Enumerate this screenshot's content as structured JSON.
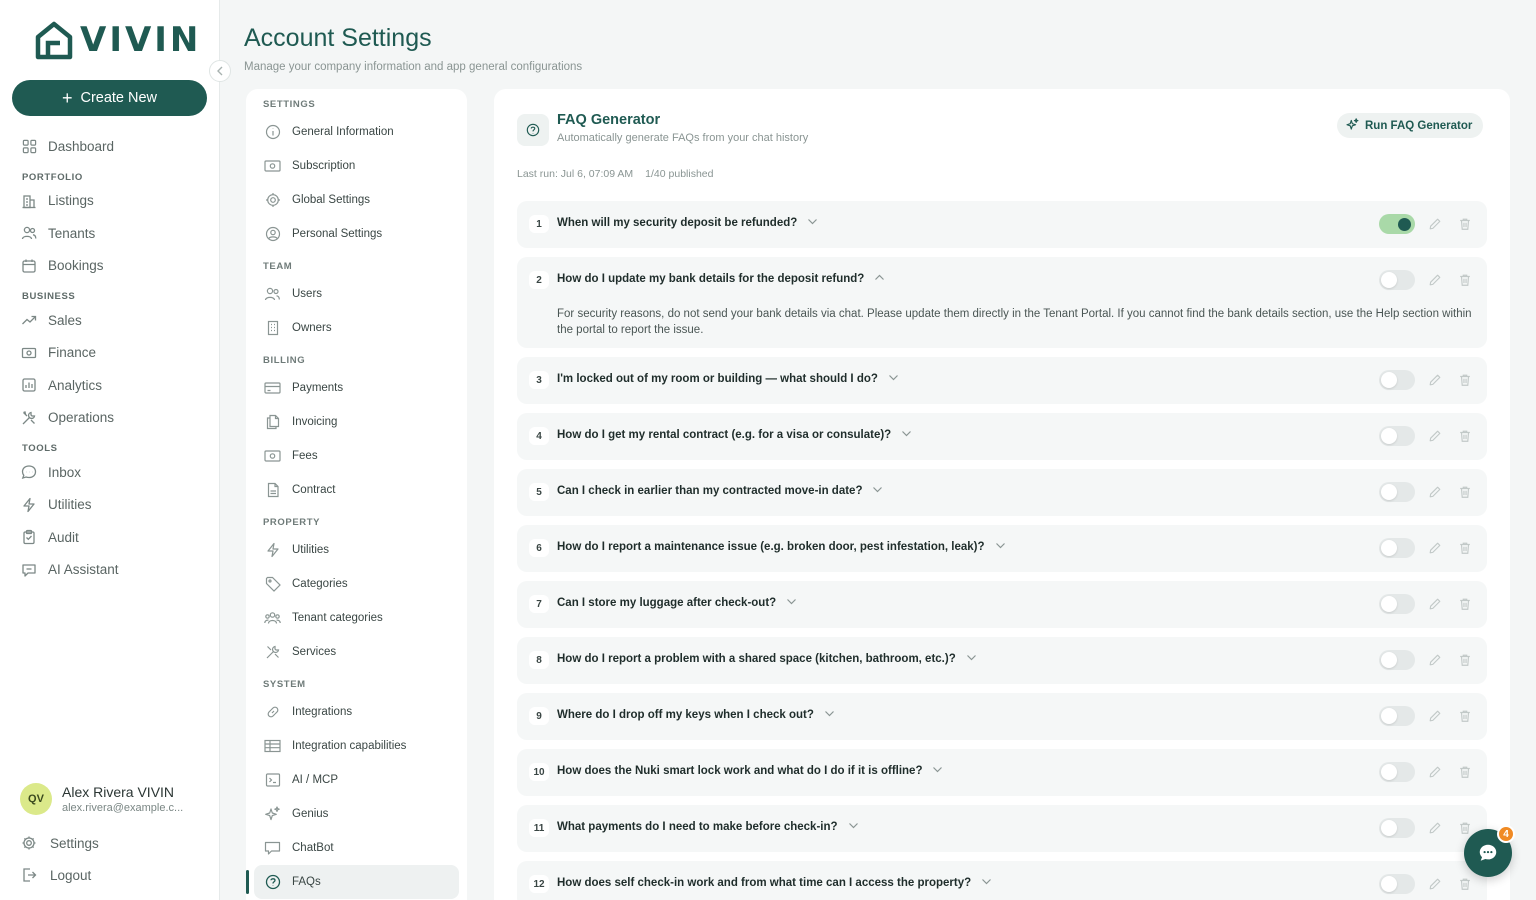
{
  "brand": {
    "name": "VIVIN",
    "color": "#1f5a52"
  },
  "sidebar": {
    "create_label": "Create New",
    "dashboard": {
      "label": "Dashboard",
      "icon": "grid-icon"
    },
    "sections": [
      {
        "title": "PORTFOLIO",
        "items": [
          {
            "label": "Listings",
            "icon": "building-icon"
          },
          {
            "label": "Tenants",
            "icon": "users-icon"
          },
          {
            "label": "Bookings",
            "icon": "calendar-icon"
          }
        ]
      },
      {
        "title": "BUSINESS",
        "items": [
          {
            "label": "Sales",
            "icon": "trend-icon"
          },
          {
            "label": "Finance",
            "icon": "cash-icon"
          },
          {
            "label": "Analytics",
            "icon": "chart-icon"
          },
          {
            "label": "Operations",
            "icon": "tools-icon"
          }
        ]
      },
      {
        "title": "TOOLS",
        "items": [
          {
            "label": "Inbox",
            "icon": "chat-icon"
          },
          {
            "label": "Utilities",
            "icon": "bolt-icon"
          },
          {
            "label": "Audit",
            "icon": "clipboard-icon"
          },
          {
            "label": "AI Assistant",
            "icon": "ai-chat-icon"
          }
        ]
      }
    ],
    "user": {
      "initials": "QV",
      "name": "Alex Rivera VIVIN",
      "email": "alex.rivera@example.c..."
    },
    "settings_label": "Settings",
    "logout_label": "Logout"
  },
  "header": {
    "title": "Account Settings",
    "subtitle": "Manage your company information and app general configurations"
  },
  "settings_menu": {
    "sections": [
      {
        "title": "SETTINGS",
        "items": [
          "General Information",
          "Subscription",
          "Global Settings",
          "Personal Settings"
        ]
      },
      {
        "title": "TEAM",
        "items": [
          "Users",
          "Owners"
        ]
      },
      {
        "title": "BILLING",
        "items": [
          "Payments",
          "Invoicing",
          "Fees",
          "Contract"
        ]
      },
      {
        "title": "PROPERTY",
        "items": [
          "Utilities",
          "Categories",
          "Tenant categories",
          "Services"
        ]
      },
      {
        "title": "SYSTEM",
        "items": [
          "Integrations",
          "Integration capabilities",
          "AI / MCP",
          "Genius",
          "ChatBot",
          "FAQs"
        ]
      }
    ],
    "active": "FAQs"
  },
  "faq": {
    "title": "FAQ Generator",
    "subtitle": "Automatically generate FAQs from your chat history",
    "run_label": "Run FAQ Generator",
    "last_run": "Last run: Jul 6, 07:09 AM",
    "published": "1/40 published",
    "items": [
      {
        "num": "1",
        "q": "When will my security deposit be refunded?",
        "enabled": true,
        "expanded": false
      },
      {
        "num": "2",
        "q": "How do I update my bank details for the deposit refund?",
        "enabled": false,
        "expanded": true,
        "a": "For security reasons, do not send your bank details via chat. Please update them directly in the Tenant Portal. If you cannot find the bank details section, use the Help section within the portal to report the issue."
      },
      {
        "num": "3",
        "q": "I'm locked out of my room or building — what should I do?",
        "enabled": false,
        "expanded": false
      },
      {
        "num": "4",
        "q": "How do I get my rental contract (e.g. for a visa or consulate)?",
        "enabled": false,
        "expanded": false
      },
      {
        "num": "5",
        "q": "Can I check in earlier than my contracted move-in date?",
        "enabled": false,
        "expanded": false
      },
      {
        "num": "6",
        "q": "How do I report a maintenance issue (e.g. broken door, pest infestation, leak)?",
        "enabled": false,
        "expanded": false
      },
      {
        "num": "7",
        "q": "Can I store my luggage after check-out?",
        "enabled": false,
        "expanded": false
      },
      {
        "num": "8",
        "q": "How do I report a problem with a shared space (kitchen, bathroom, etc.)?",
        "enabled": false,
        "expanded": false
      },
      {
        "num": "9",
        "q": "Where do I drop off my keys when I check out?",
        "enabled": false,
        "expanded": false
      },
      {
        "num": "10",
        "q": "How does the Nuki smart lock work and what do I do if it is offline?",
        "enabled": false,
        "expanded": false
      },
      {
        "num": "11",
        "q": "What payments do I need to make before check-in?",
        "enabled": false,
        "expanded": false
      },
      {
        "num": "12",
        "q": "How does self check-in work and from what time can I access the property?",
        "enabled": false,
        "expanded": false
      }
    ]
  },
  "chat_widget": {
    "badge": "4"
  }
}
